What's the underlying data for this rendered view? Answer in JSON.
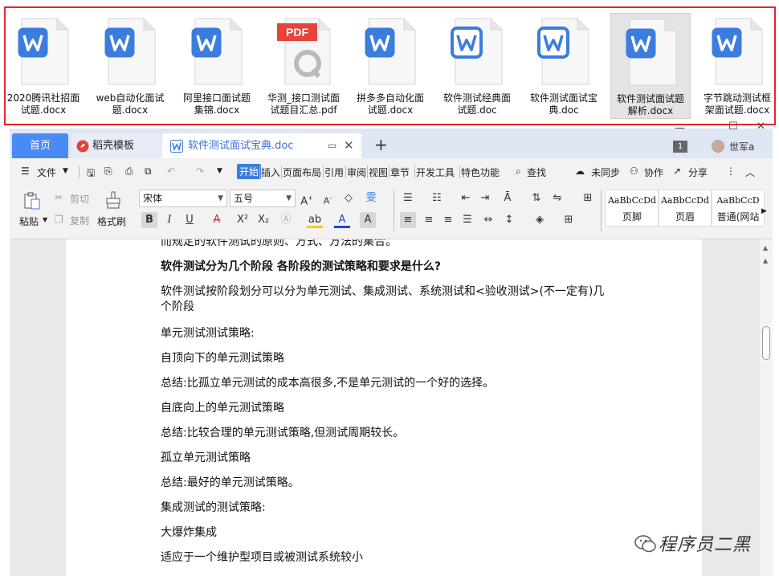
{
  "files": [
    {
      "type": "word",
      "name_line1": "2020腾讯社招面",
      "name_line2": "试题.docx"
    },
    {
      "type": "word",
      "name_line1": "web自动化面试",
      "name_line2": "题.docx"
    },
    {
      "type": "word",
      "name_line1": "阿里接口面试题",
      "name_line2": "集锦.docx"
    },
    {
      "type": "pdf",
      "name_line1": "华测_接口测试面",
      "name_line2": "试题目汇总.pdf",
      "badge": "PDF"
    },
    {
      "type": "word",
      "name_line1": "拼多多自动化面",
      "name_line2": "试题.docx"
    },
    {
      "type": "word-doc",
      "name_line1": "软件测试经典面",
      "name_line2": "试题.doc"
    },
    {
      "type": "word-doc",
      "name_line1": "软件测试面试宝",
      "name_line2": "典.doc"
    },
    {
      "type": "word",
      "name_line1": "软件测试面试题",
      "name_line2": "解析.docx",
      "selected": true
    },
    {
      "type": "word",
      "name_line1": "字节跳动测试框",
      "name_line2": "架面试题.docx"
    }
  ],
  "tabs": {
    "home": "首页",
    "template": "稻壳模板",
    "doc": "软件测试面试宝典.doc"
  },
  "window": {
    "page_badge": "1",
    "username": "世军a"
  },
  "menu": {
    "file": "文件",
    "items": [
      "开始",
      "插入",
      "页面布局",
      "引用",
      "审阅",
      "视图",
      "章节",
      "开发工具",
      "特色功能"
    ],
    "search": "查找",
    "unsynced": "未同步",
    "collab": "协作",
    "share": "分享"
  },
  "ribbon": {
    "paste": "粘贴",
    "cut": "剪切",
    "copy": "复制",
    "format_painter": "格式刷",
    "font_name": "宋体",
    "font_size": "五号",
    "styles": [
      {
        "sample": "AaBbCcDd",
        "label": "页脚"
      },
      {
        "sample": "AaBbCcDd",
        "label": "页眉"
      },
      {
        "sample": "AaBbCcD",
        "label": "普通(网站"
      }
    ]
  },
  "document": {
    "paragraphs": [
      {
        "text": "而规定的软件测试的原则、方式、方法的集合。",
        "bold": false
      },
      {
        "text": "软件测试分为几个阶段  各阶段的测试策略和要求是什么?",
        "bold": true
      },
      {
        "text": "软件测试按阶段划分可以分为单元测试、集成测试、系统测试和<验收测试>(不一定有)几个阶段",
        "bold": false
      },
      {
        "text": "单元测试测试策略:",
        "bold": false
      },
      {
        "text": "自顶向下的单元测试策略",
        "bold": false
      },
      {
        "text": "总结:比孤立单元测试的成本高很多,不是单元测试的一个好的选择。",
        "bold": false
      },
      {
        "text": "自底向上的单元测试策略",
        "bold": false
      },
      {
        "text": "总结:比较合理的单元测试策略,但测试周期较长。",
        "bold": false
      },
      {
        "text": "孤立单元测试策略",
        "bold": false
      },
      {
        "text": "总结:最好的单元测试策略。",
        "bold": false
      },
      {
        "text": "集成测试的测试策略:",
        "bold": false
      },
      {
        "text": "大爆炸集成",
        "bold": false
      },
      {
        "text": "适应于一个维护型项目或被测试系统较小",
        "bold": false
      }
    ]
  },
  "watermark": "程序员二黑",
  "colors": {
    "highlight_frame": "#e5262c",
    "wps_blue": "#3b7ddd",
    "pdf_red": "#e8433a",
    "tab_home": "#4a8af4"
  }
}
